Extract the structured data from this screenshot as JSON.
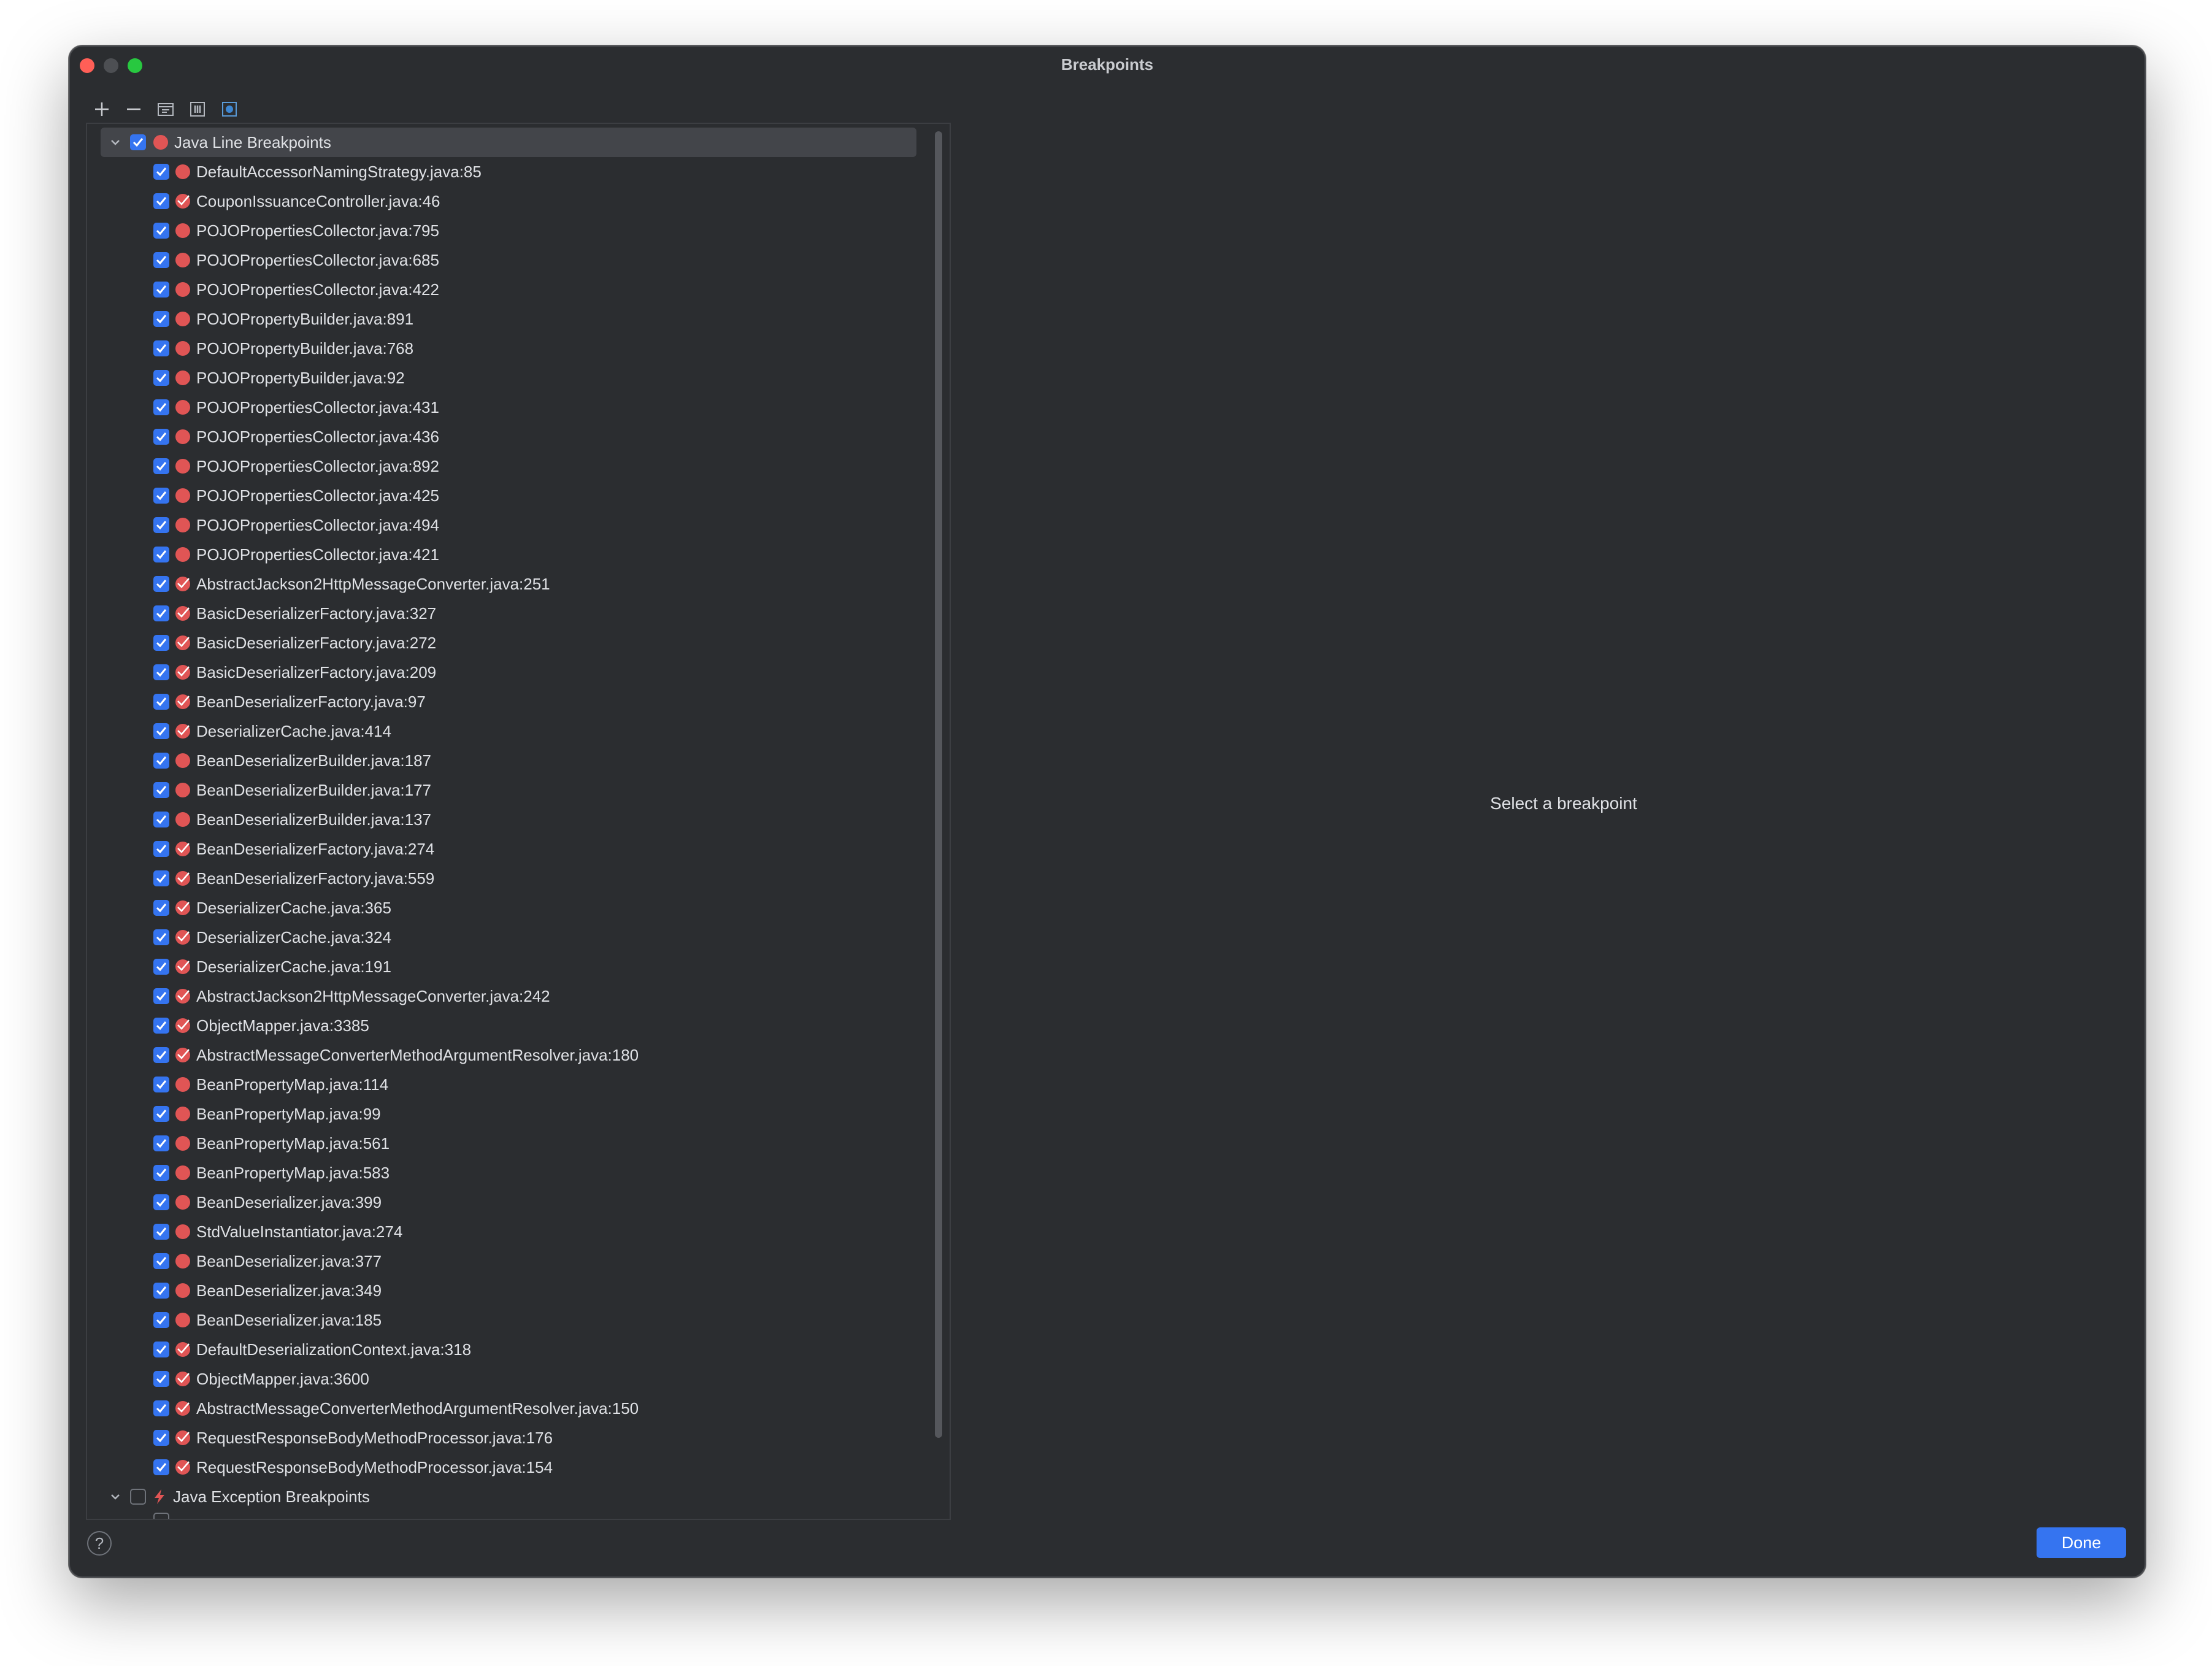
{
  "window": {
    "title": "Breakpoints"
  },
  "toolbar": [
    {
      "name": "add-breakpoint-button",
      "icon": "plus-icon"
    },
    {
      "name": "remove-breakpoint-button",
      "icon": "minus-icon"
    },
    {
      "name": "group-by-package-button",
      "icon": "package-group-icon"
    },
    {
      "name": "group-by-file-button",
      "icon": "file-group-icon"
    },
    {
      "name": "group-by-class-button",
      "icon": "class-group-icon"
    }
  ],
  "tree": {
    "line_group": {
      "label": "Java Line Breakpoints",
      "checked": true,
      "expanded": true,
      "icon": "breakpoint-dot-icon"
    },
    "items": [
      {
        "label": "DefaultAccessorNamingStrategy.java:85",
        "icon": "breakpoint-dot-icon"
      },
      {
        "label": "CouponIssuanceController.java:46",
        "icon": "breakpoint-check-icon"
      },
      {
        "label": "POJOPropertiesCollector.java:795",
        "icon": "breakpoint-dot-icon"
      },
      {
        "label": "POJOPropertiesCollector.java:685",
        "icon": "breakpoint-dot-icon"
      },
      {
        "label": "POJOPropertiesCollector.java:422",
        "icon": "breakpoint-dot-icon"
      },
      {
        "label": "POJOPropertyBuilder.java:891",
        "icon": "breakpoint-dot-icon"
      },
      {
        "label": "POJOPropertyBuilder.java:768",
        "icon": "breakpoint-dot-icon"
      },
      {
        "label": "POJOPropertyBuilder.java:92",
        "icon": "breakpoint-dot-icon"
      },
      {
        "label": "POJOPropertiesCollector.java:431",
        "icon": "breakpoint-dot-icon"
      },
      {
        "label": "POJOPropertiesCollector.java:436",
        "icon": "breakpoint-dot-icon"
      },
      {
        "label": "POJOPropertiesCollector.java:892",
        "icon": "breakpoint-dot-icon"
      },
      {
        "label": "POJOPropertiesCollector.java:425",
        "icon": "breakpoint-dot-icon"
      },
      {
        "label": "POJOPropertiesCollector.java:494",
        "icon": "breakpoint-dot-icon"
      },
      {
        "label": "POJOPropertiesCollector.java:421",
        "icon": "breakpoint-dot-icon"
      },
      {
        "label": "AbstractJackson2HttpMessageConverter.java:251",
        "icon": "breakpoint-check-icon"
      },
      {
        "label": "BasicDeserializerFactory.java:327",
        "icon": "breakpoint-check-icon"
      },
      {
        "label": "BasicDeserializerFactory.java:272",
        "icon": "breakpoint-check-icon"
      },
      {
        "label": "BasicDeserializerFactory.java:209",
        "icon": "breakpoint-check-icon"
      },
      {
        "label": "BeanDeserializerFactory.java:97",
        "icon": "breakpoint-check-icon"
      },
      {
        "label": "DeserializerCache.java:414",
        "icon": "breakpoint-check-icon"
      },
      {
        "label": "BeanDeserializerBuilder.java:187",
        "icon": "breakpoint-dot-icon"
      },
      {
        "label": "BeanDeserializerBuilder.java:177",
        "icon": "breakpoint-dot-icon"
      },
      {
        "label": "BeanDeserializerBuilder.java:137",
        "icon": "breakpoint-dot-icon"
      },
      {
        "label": "BeanDeserializerFactory.java:274",
        "icon": "breakpoint-check-icon"
      },
      {
        "label": "BeanDeserializerFactory.java:559",
        "icon": "breakpoint-check-icon"
      },
      {
        "label": "DeserializerCache.java:365",
        "icon": "breakpoint-check-icon"
      },
      {
        "label": "DeserializerCache.java:324",
        "icon": "breakpoint-check-icon"
      },
      {
        "label": "DeserializerCache.java:191",
        "icon": "breakpoint-check-icon"
      },
      {
        "label": "AbstractJackson2HttpMessageConverter.java:242",
        "icon": "breakpoint-check-icon"
      },
      {
        "label": "ObjectMapper.java:3385",
        "icon": "breakpoint-check-icon"
      },
      {
        "label": "AbstractMessageConverterMethodArgumentResolver.java:180",
        "icon": "breakpoint-check-icon"
      },
      {
        "label": "BeanPropertyMap.java:114",
        "icon": "breakpoint-dot-icon"
      },
      {
        "label": "BeanPropertyMap.java:99",
        "icon": "breakpoint-dot-icon"
      },
      {
        "label": "BeanPropertyMap.java:561",
        "icon": "breakpoint-dot-icon"
      },
      {
        "label": "BeanPropertyMap.java:583",
        "icon": "breakpoint-dot-icon"
      },
      {
        "label": "BeanDeserializer.java:399",
        "icon": "breakpoint-dot-icon"
      },
      {
        "label": "StdValueInstantiator.java:274",
        "icon": "breakpoint-dot-icon"
      },
      {
        "label": "BeanDeserializer.java:377",
        "icon": "breakpoint-dot-icon"
      },
      {
        "label": "BeanDeserializer.java:349",
        "icon": "breakpoint-dot-icon"
      },
      {
        "label": "BeanDeserializer.java:185",
        "icon": "breakpoint-dot-icon"
      },
      {
        "label": "DefaultDeserializationContext.java:318",
        "icon": "breakpoint-check-icon"
      },
      {
        "label": "ObjectMapper.java:3600",
        "icon": "breakpoint-check-icon"
      },
      {
        "label": "AbstractMessageConverterMethodArgumentResolver.java:150",
        "icon": "breakpoint-check-icon"
      },
      {
        "label": "RequestResponseBodyMethodProcessor.java:176",
        "icon": "breakpoint-check-icon"
      },
      {
        "label": "RequestResponseBodyMethodProcessor.java:154",
        "icon": "breakpoint-check-icon"
      }
    ],
    "exception_group": {
      "label": "Java Exception Breakpoints",
      "checked": false,
      "expanded": true,
      "icon": "lightning-icon"
    }
  },
  "detail": {
    "placeholder": "Select a breakpoint"
  },
  "footer": {
    "help_label": "?",
    "done_label": "Done"
  },
  "colors": {
    "accent": "#3574f0",
    "breakpoint": "#e05555",
    "background": "#2b2d30"
  }
}
